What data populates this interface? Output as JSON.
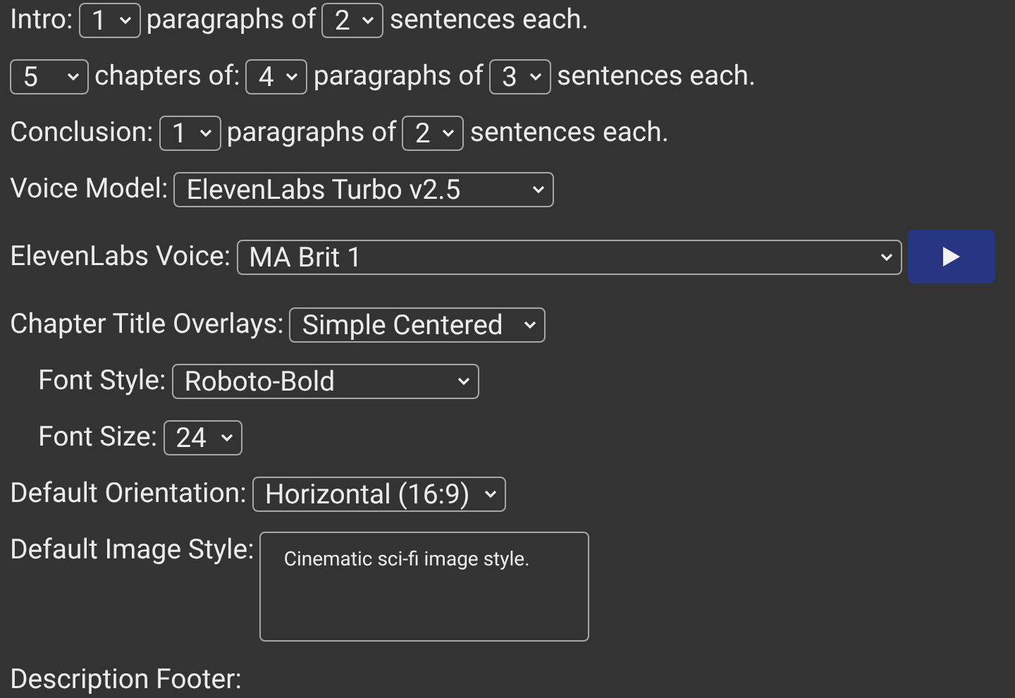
{
  "rows": [
    {
      "indented": false,
      "parts": [
        {
          "kind": "label",
          "text": "Intro:"
        },
        {
          "kind": "select",
          "value": "1"
        },
        {
          "kind": "label",
          "text": "paragraphs of"
        },
        {
          "kind": "select",
          "value": "2"
        },
        {
          "kind": "label",
          "text": "sentences each."
        }
      ]
    },
    {
      "indented": false,
      "parts": [
        {
          "kind": "select",
          "value": "5"
        },
        {
          "kind": "label",
          "text": "chapters of:"
        },
        {
          "kind": "select",
          "value": "4"
        },
        {
          "kind": "label",
          "text": "paragraphs of"
        },
        {
          "kind": "select",
          "value": "3"
        },
        {
          "kind": "label",
          "text": "sentences each."
        }
      ]
    },
    {
      "indented": false,
      "parts": [
        {
          "kind": "label",
          "text": "Conclusion:"
        },
        {
          "kind": "select",
          "value": "1"
        },
        {
          "kind": "label",
          "text": "paragraphs of"
        },
        {
          "kind": "select",
          "value": "2"
        },
        {
          "kind": "label",
          "text": "sentences each."
        }
      ]
    },
    {
      "indented": false,
      "parts": [
        {
          "kind": "label",
          "text": "Voice Model:"
        },
        {
          "kind": "select",
          "value": "ElevenLabs Turbo v2.5"
        }
      ]
    },
    {
      "indented": false,
      "parts": [
        {
          "kind": "label",
          "text": "ElevenLabs Voice:"
        },
        {
          "kind": "select",
          "value": "MA Brit 1"
        },
        {
          "kind": "button"
        }
      ]
    },
    {
      "indented": false,
      "parts": [
        {
          "kind": "label",
          "text": "Chapter Title Overlays:"
        },
        {
          "kind": "select",
          "value": "Simple Centered"
        }
      ]
    },
    {
      "indented": true,
      "parts": [
        {
          "kind": "label",
          "text": "Font Style:"
        },
        {
          "kind": "select",
          "value": "Roboto-Bold"
        }
      ]
    },
    {
      "indented": true,
      "parts": [
        {
          "kind": "label",
          "text": "Font Size:"
        },
        {
          "kind": "select",
          "value": "24"
        }
      ]
    },
    {
      "indented": false,
      "parts": [
        {
          "kind": "label",
          "text": "Default Orientation:"
        },
        {
          "kind": "select",
          "value": "Horizontal (16:9)"
        }
      ]
    },
    {
      "indented": false,
      "parts": [
        {
          "kind": "label",
          "text": "Default Image Style:"
        },
        {
          "kind": "textarea",
          "value": "Cinematic sci-fi image style."
        }
      ]
    },
    {
      "indented": false,
      "parts": [
        {
          "kind": "label",
          "text": "Description Footer:"
        }
      ]
    }
  ]
}
